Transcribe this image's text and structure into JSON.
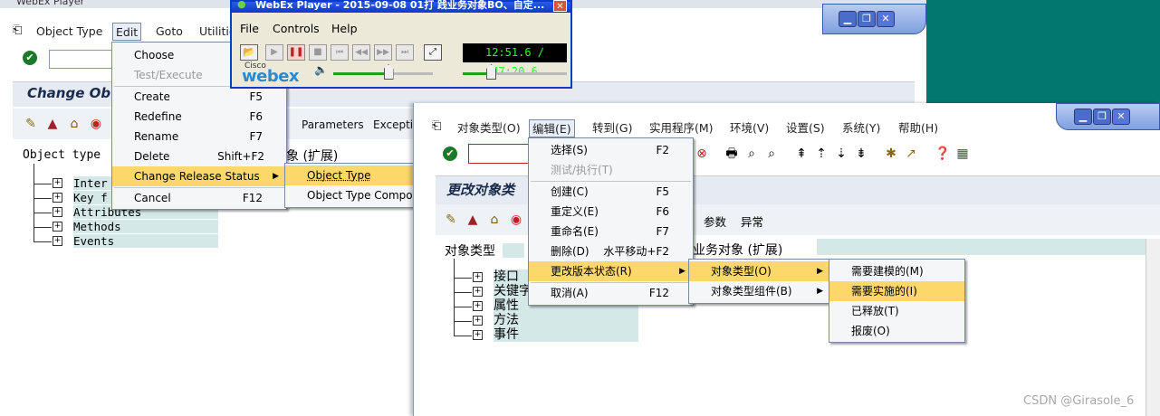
{
  "back_window": {
    "title": "WebEx Player",
    "menubar": [
      "Object Type",
      "Edit",
      "Goto",
      "Utilitie"
    ],
    "header_title": "Change Ob",
    "toolbar_labels": {
      "params": "Parameters",
      "exceptions": "Exceptio"
    },
    "tree_label": "Object type",
    "tree_label_right": "象 (扩展)",
    "tree_items": [
      "Inter",
      "Key f",
      "Attributes",
      "Methods",
      "Events"
    ]
  },
  "back_edit_menu": [
    {
      "label": "Choose",
      "shortcut": "",
      "disabled": false
    },
    {
      "label": "Test/Execute",
      "shortcut": "",
      "disabled": true
    },
    {
      "label": "Create",
      "shortcut": "F5",
      "disabled": false
    },
    {
      "label": "Redefine",
      "shortcut": "F6",
      "disabled": false
    },
    {
      "label": "Rename",
      "shortcut": "F7",
      "disabled": false
    },
    {
      "label": "Delete",
      "shortcut": "Shift+F2",
      "disabled": false
    },
    {
      "label": "Change Release Status",
      "shortcut": "",
      "disabled": false
    },
    {
      "label": "Cancel",
      "shortcut": "F12",
      "disabled": false
    }
  ],
  "back_submenu": [
    "Object Type",
    "Object Type Compor"
  ],
  "player": {
    "title": "WebEx Player - 2015-09-08 01打 践业务对象BO、自定...",
    "menu": [
      "File",
      "Controls",
      "Help"
    ],
    "time": "12:51.6 / 47:20.6",
    "brand_small": "Cisco",
    "brand": "webex",
    "progress": 0.27,
    "volume": 0.55
  },
  "front_window": {
    "menubar": [
      "对象类型(O)",
      "编辑(E)",
      "转到(G)",
      "实用程序(M)",
      "环境(V)",
      "设置(S)",
      "系统(Y)",
      "帮助(H)"
    ],
    "header_title": "更改对象类",
    "toolbar_labels": {
      "params": "参数",
      "exceptions": "异常"
    },
    "tree_label": "对象类型",
    "tree_label_right": "业务对象 (扩展)",
    "tree_items": [
      "接口",
      "关键字",
      "属性",
      "方法",
      "事件"
    ]
  },
  "front_edit_menu": [
    {
      "label": "选择(S)",
      "shortcut": "F2",
      "disabled": false
    },
    {
      "label": "测试/执行(T)",
      "shortcut": "",
      "disabled": true
    },
    {
      "label": "创建(C)",
      "shortcut": "F5",
      "disabled": false
    },
    {
      "label": "重定义(E)",
      "shortcut": "F6",
      "disabled": false
    },
    {
      "label": "重命名(E)",
      "shortcut": "F7",
      "disabled": false
    },
    {
      "label": "删除(D)",
      "shortcut": "水平移动+F2",
      "disabled": false
    },
    {
      "label": "更改版本状态(R)",
      "shortcut": "",
      "disabled": false
    },
    {
      "label": "取消(A)",
      "shortcut": "F12",
      "disabled": false
    }
  ],
  "front_submenu": [
    "对象类型(O)",
    "对象类型组件(B)"
  ],
  "front_submenu2": [
    "需要建模的(M)",
    "需要实施的(I)",
    "已释放(T)",
    "报废(O)"
  ],
  "watermark": "CSDN @Girasole_6",
  "colors": {
    "highlight": "#fcd76a",
    "teal_bg": "#007870",
    "sap_band": "#e6ebf3",
    "title_blue": "#1c3c94"
  }
}
